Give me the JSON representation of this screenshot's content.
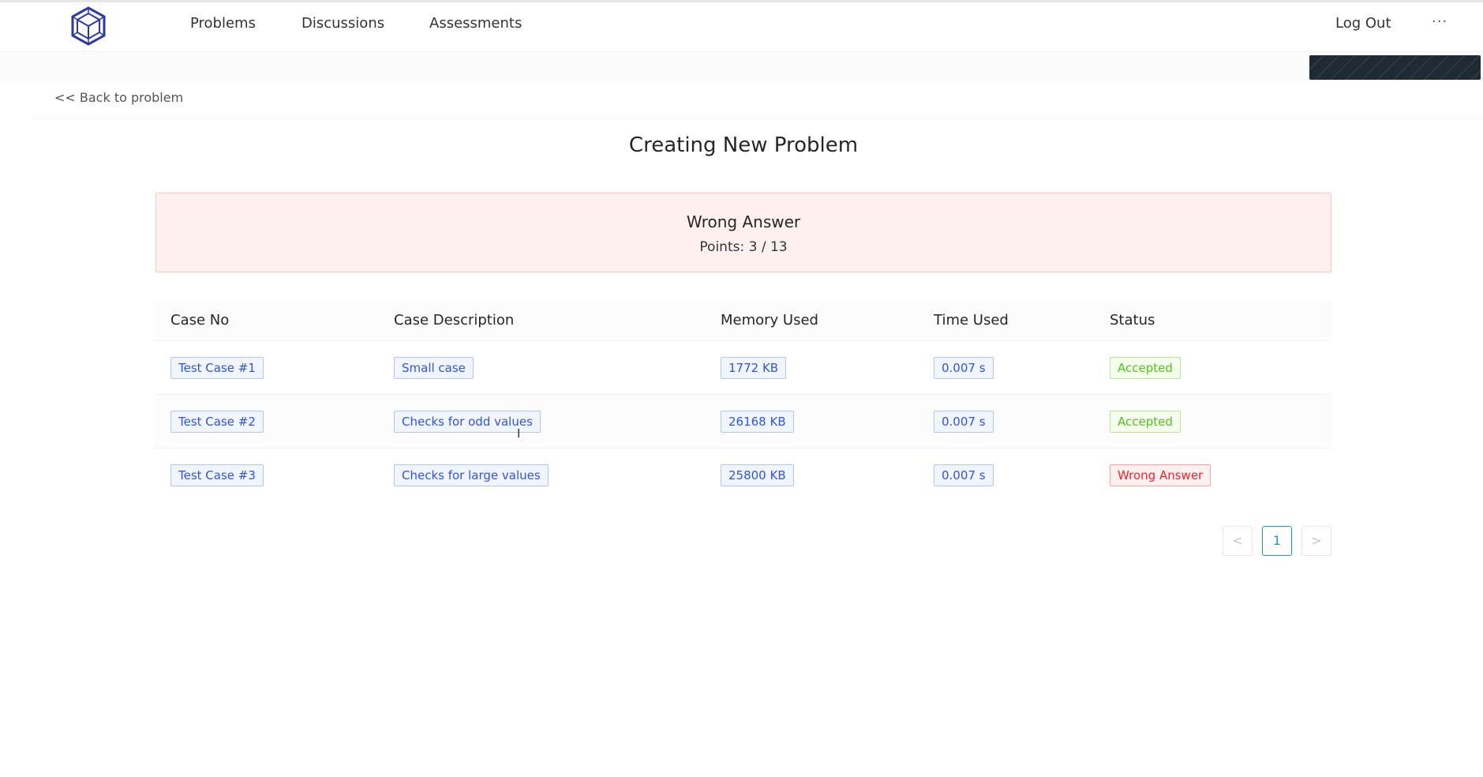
{
  "header": {
    "logo_icon": "hexagon-cube-logo-icon",
    "nav": [
      {
        "label": "Problems"
      },
      {
        "label": "Discussions"
      },
      {
        "label": "Assessments"
      }
    ],
    "logout_label": "Log Out",
    "more_label": "···"
  },
  "back_link": "<< Back to problem",
  "page_title": "Creating New Problem",
  "result": {
    "verdict": "Wrong Answer",
    "points": "Points: 3 / 13",
    "background_color": "#fdf0ee"
  },
  "table": {
    "headers": [
      "Case No",
      "Case Description",
      "Memory Used",
      "Time Used",
      "Status"
    ],
    "rows": [
      {
        "case_no": "Test Case #1",
        "description": "Small case",
        "memory": "1772 KB",
        "time": "0.007 s",
        "status": "Accepted",
        "status_color": "#52c41a"
      },
      {
        "case_no": "Test Case #2",
        "description": "Checks for odd values",
        "memory": "26168 KB",
        "time": "0.007 s",
        "status": "Accepted",
        "status_color": "#52c41a"
      },
      {
        "case_no": "Test Case #3",
        "description": "Checks for large values",
        "memory": "25800 KB",
        "time": "0.007 s",
        "status": "Wrong Answer",
        "status_color": "#f5222d"
      }
    ]
  },
  "pagination": {
    "prev": "<",
    "current_page": "1",
    "next": ">",
    "accent_color": "#1890ff"
  },
  "cursor_glyph": "I"
}
